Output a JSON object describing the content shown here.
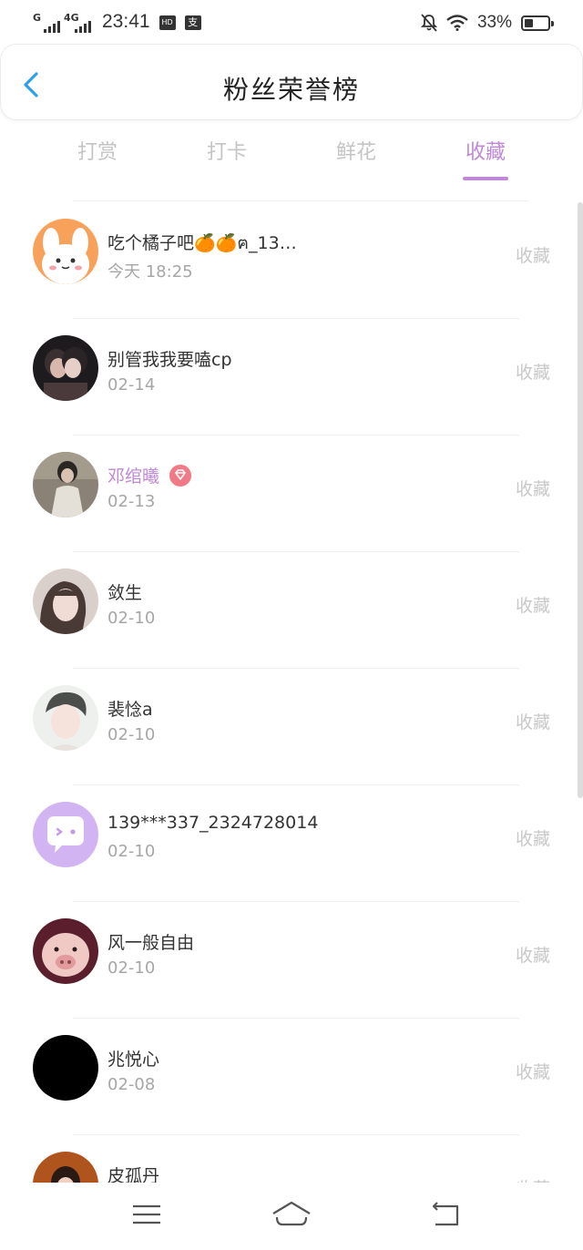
{
  "status_bar": {
    "net1_label": "G",
    "net2_label": "4G",
    "time": "23:41",
    "badge1": "HD",
    "badge2": "支",
    "battery": "33%"
  },
  "header": {
    "title": "粉丝荣誉榜"
  },
  "tabs": [
    {
      "label": "打赏"
    },
    {
      "label": "打卡"
    },
    {
      "label": "鲜花"
    },
    {
      "label": "收藏"
    }
  ],
  "active_tab": "收藏",
  "fans": [
    {
      "name": "吃个橘子吧🍊🍊ฅ_13…",
      "date": "今天 18:25",
      "action": "收藏"
    },
    {
      "name": "别管我我要嗑cp",
      "date": "02-14",
      "action": "收藏"
    },
    {
      "name": "邓绾曦",
      "date": "02-13",
      "action": "收藏"
    },
    {
      "name": "敛生",
      "date": "02-10",
      "action": "收藏"
    },
    {
      "name": "裴惗a",
      "date": "02-10",
      "action": "收藏"
    },
    {
      "name": "139***337_2324728014",
      "date": "02-10",
      "action": "收藏"
    },
    {
      "name": "风一般自由",
      "date": "02-10",
      "action": "收藏"
    },
    {
      "name": "兆悦心",
      "date": "02-08",
      "action": "收藏"
    },
    {
      "name": "皮孤丹",
      "date": "",
      "action": "收藏"
    }
  ],
  "colors": {
    "accent": "#c088d8",
    "back_arrow": "#2ea0e8",
    "muted": "#c4c4c4"
  }
}
